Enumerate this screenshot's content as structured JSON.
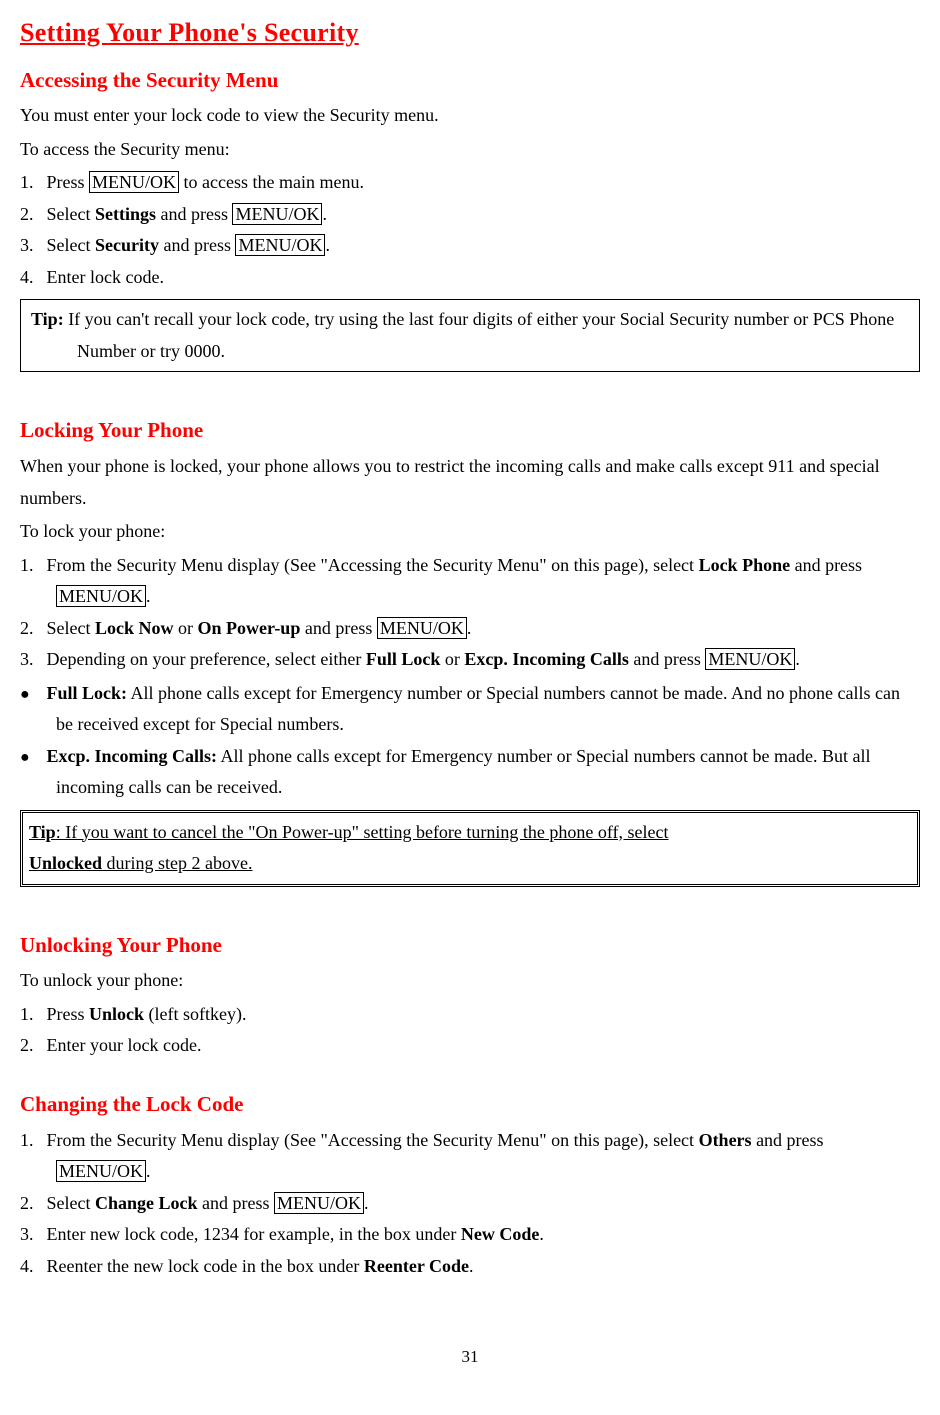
{
  "page": {
    "title": "Setting Your Phone's Security",
    "number": "31"
  },
  "key": {
    "menuok": "MENU/OK"
  },
  "s1": {
    "heading": "Accessing the Security Menu",
    "p1": "You must enter your lock code to view the Security menu.",
    "p2": "To access the Security menu:",
    "li1a": "1.",
    "li1b": "Press ",
    "li1c": " to access the main menu.",
    "li2a": "2.",
    "li2b": "Select ",
    "li2c": "Settings",
    "li2d": " and press ",
    "li3a": "3.",
    "li3b": "Select ",
    "li3c": "Security",
    "li3d": " and press ",
    "li4a": "4.",
    "li4b": "Enter lock code.",
    "tip_label": "Tip:",
    "tip_body": " If you can't recall your lock code, try using the last four digits of either your Social Security number or PCS Phone Number or try 0000."
  },
  "s2": {
    "heading": "Locking Your Phone",
    "p1": "When your phone is locked, your phone allows you to restrict the incoming calls and make calls except 911 and special numbers.",
    "p2": "To lock your phone:",
    "li1a": "1.",
    "li1b": "From the Security Menu display (See \"Accessing the Security Menu\" on this page), select ",
    "li1c": "Lock Phone",
    "li1d": " and press ",
    "li2a": "2.",
    "li2b": "Select ",
    "li2c": "Lock Now",
    "li2d": " or ",
    "li2e": "On Power-up",
    "li2f": " and press ",
    "li3a": "3.",
    "li3b": "Depending on your preference, select either ",
    "li3c": "Full Lock",
    "li3d": " or ",
    "li3e": "Excp. Incoming Calls",
    "li3f": " and press ",
    "b1a": "Full Lock:",
    "b1b": " All phone calls except for Emergency number or Special numbers cannot be made. And no phone calls can be received except for Special numbers.",
    "b2a": "Excp. Incoming Calls:",
    "b2b": " All phone calls except for Emergency number or Special numbers cannot be made. But all incoming calls can be received.",
    "tip_label": "Tip",
    "tip_a": ": If you want to cancel the \"On Power-up\" setting before turning the phone off, select ",
    "tip_b": "Unlocked",
    "tip_c": " during step 2 above."
  },
  "s3": {
    "heading": "Unlocking Your Phone",
    "p1": "To unlock your phone:",
    "li1a": "1.",
    "li1b": "Press ",
    "li1c": "Unlock",
    "li1d": " (left softkey).",
    "li2a": "2.",
    "li2b": "Enter your lock code."
  },
  "s4": {
    "heading": "Changing the Lock Code",
    "li1a": "1.",
    "li1b": "From the Security Menu display (See \"Accessing the Security Menu\" on this page), select ",
    "li1c": "Others",
    "li1d": " and press ",
    "li2a": "2.",
    "li2b": "Select ",
    "li2c": "Change Lock",
    "li2d": " and press ",
    "li3a": "3.",
    "li3b": "Enter new lock code, 1234 for example, in the box under ",
    "li3c": "New Code",
    "li4a": "4.",
    "li4b": "Reenter the new lock code in the box under ",
    "li4c": "Reenter Code"
  },
  "dot": "."
}
